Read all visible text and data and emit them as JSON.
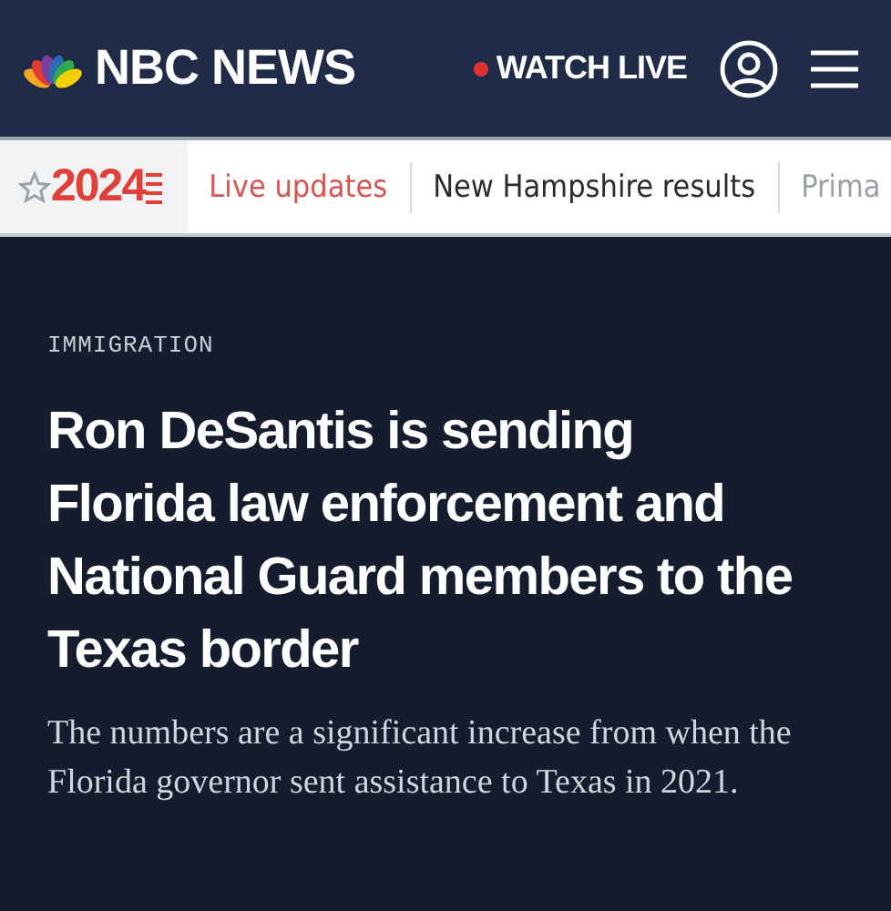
{
  "header": {
    "brand": "NBC NEWS",
    "watch_live": "WATCH LIVE"
  },
  "election_bar": {
    "year": "2024",
    "links": [
      {
        "label": "Live updates",
        "highlighted": true
      },
      {
        "label": "New Hampshire results",
        "highlighted": false
      },
      {
        "label": "Prima",
        "highlighted": false
      }
    ]
  },
  "article": {
    "category": "IMMIGRATION",
    "headline": "Ron DeSantis is sending Florida law enforcement and National Guard members to the Texas border",
    "dek": "The numbers are a significant increase from when the Florida governor sent assistance to Texas in 2021."
  }
}
